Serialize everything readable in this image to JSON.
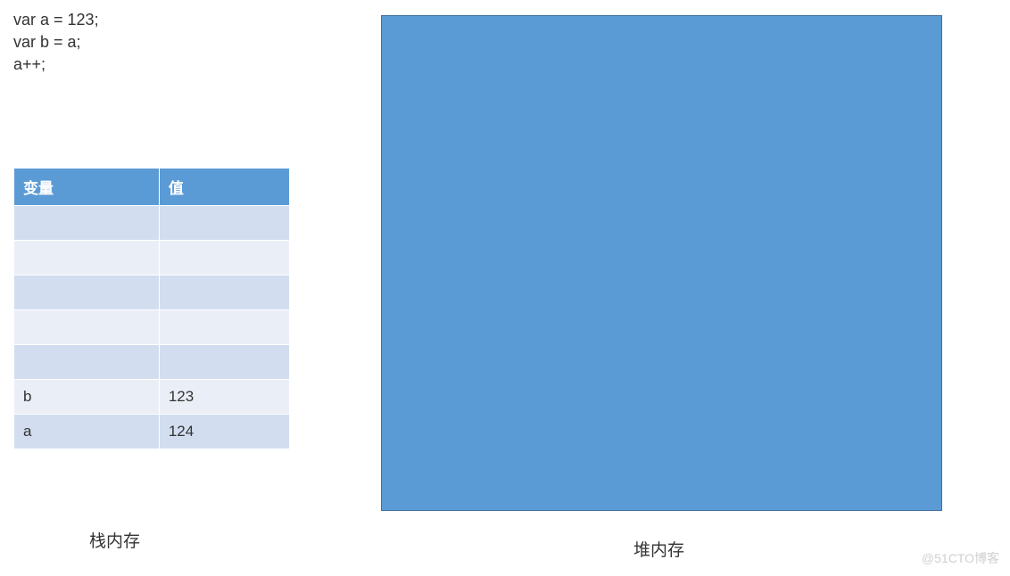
{
  "code": {
    "line1": "var a = 123;",
    "line2": "var b = a;",
    "line3": "a++;"
  },
  "stack_table": {
    "header_variable": "变量",
    "header_value": "值",
    "rows": [
      {
        "variable": "",
        "value": ""
      },
      {
        "variable": "",
        "value": ""
      },
      {
        "variable": "",
        "value": ""
      },
      {
        "variable": "",
        "value": ""
      },
      {
        "variable": "",
        "value": ""
      },
      {
        "variable": "b",
        "value": "123"
      },
      {
        "variable": "a",
        "value": "124"
      }
    ]
  },
  "labels": {
    "stack": "栈内存",
    "heap": "堆内存"
  },
  "watermark": "@51CTO博客"
}
